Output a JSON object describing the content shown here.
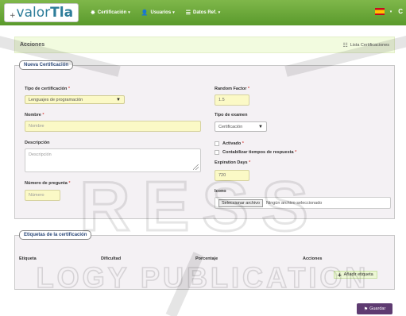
{
  "navbar": {
    "brand_plus": "+",
    "brand_prefix": "valor",
    "brand_suffix": "Tla",
    "menu": [
      {
        "label": "Certificación",
        "icon": "star-icon"
      },
      {
        "label": "Usuarios",
        "icon": "user-icon"
      },
      {
        "label": "Datos Ref.",
        "icon": "list-icon"
      }
    ],
    "right_letter": "C"
  },
  "header": {
    "title": "Acciones",
    "link_label": "Lista Certificaciones"
  },
  "form": {
    "legend": "Nueva Certificación",
    "tipo_certificacion": {
      "label": "Tipo de certificación",
      "value": "Lenguajes de programación"
    },
    "nombre": {
      "label": "Nombre",
      "placeholder": "Nombre"
    },
    "descripcion": {
      "label": "Descripción",
      "placeholder": "Descripción"
    },
    "numero_pregunta": {
      "label": "Número de pregunta",
      "placeholder": "Número"
    },
    "random_factor": {
      "label": "Random Factor",
      "value": "1.5"
    },
    "tipo_examen": {
      "label": "Tipo de examen",
      "value": "Certificación"
    },
    "activado": {
      "label": "Activado"
    },
    "contabilizar": {
      "label": "Contabilizar tiempos de respuesta"
    },
    "expiration": {
      "label": "Expiration Days",
      "value": "720"
    },
    "icono": {
      "label": "Icono",
      "button": "Seleccionar archivo",
      "status": "Ningún archivo seleccionado"
    },
    "required_mark": "*"
  },
  "tags": {
    "legend": "Etiquetas de la certificación",
    "columns": [
      "Etiqueta",
      "Dificultad",
      "Porcentaje",
      "Acciones"
    ],
    "add_label": "Añadir etiqueta"
  },
  "save_label": "Guardar",
  "watermark": {
    "line1": "RESS",
    "line2": "LOGY PUBLICATION"
  },
  "colors": {
    "navbar": "#6aa83b",
    "save": "#5e3b71",
    "legend_text": "#2d4a7a"
  }
}
